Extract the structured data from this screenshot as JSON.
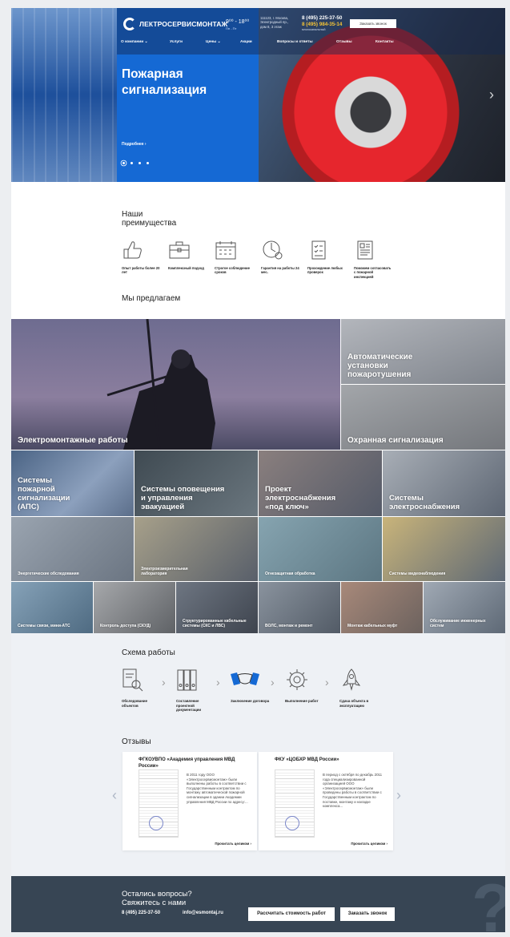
{
  "header": {
    "logo_text": "ЛЕКТРОСЕРВИСМОНТАЖ",
    "hours": "9⁰⁰ - 18⁰⁰",
    "hours_days": "Пн - Пт",
    "address": "111123, г. Москва, Электродный пр., дом 8, 3 этаж",
    "phone1": "8 (495) 225-37-50",
    "phone2": "8 (495) 984-35-14",
    "phone_note": "многоканальный",
    "callback_label": "Заказать звонок",
    "nav": [
      "О компании ⌄",
      "Услуги",
      "Цены ⌄",
      "Акции",
      "Вопросы и ответы",
      "Отзывы",
      "Контакты"
    ]
  },
  "hero": {
    "title": "Пожарная сигнализация",
    "more_label": "Подробнее ›",
    "next_icon": "chevron-right-icon"
  },
  "advantages": {
    "title": "Наши преимущества",
    "items": [
      {
        "icon": "thumbs-up-icon",
        "label": "Опыт работы более 20 лет"
      },
      {
        "icon": "briefcase-icon",
        "label": "Комплексный подход"
      },
      {
        "icon": "calendar-icon",
        "label": "Строгое соблюдение сроков"
      },
      {
        "icon": "warranty-clock-icon",
        "label": "Гарантия на работы 24 мес."
      },
      {
        "icon": "checklist-icon",
        "label": "Прохождение любых проверок"
      },
      {
        "icon": "document-icon",
        "label": "Поможем согласовать с пожарной инспекцией"
      }
    ]
  },
  "offer": {
    "title": "Мы предлагаем",
    "big": [
      {
        "label": "Электромонтажные работы",
        "color": "#6c6b8f"
      },
      {
        "label": "Автоматические установки пожаротушения",
        "color": "#8d9096"
      },
      {
        "label": "Охранная сигнализация",
        "color": "#838588"
      }
    ],
    "row2": [
      {
        "label": "Системы пожарной сигнализации (АПС)",
        "color": "#5b6c84"
      },
      {
        "label": "Системы оповещения и управления эвакуацией",
        "color": "#4d5860"
      },
      {
        "label": "Проект электроснабжения «под ключ»",
        "color": "#6a6e78"
      },
      {
        "label": "Системы электроснабжения",
        "color": "#6f7884"
      }
    ],
    "row3": [
      {
        "label": "Энергетические обследования",
        "color": "#7c8896"
      },
      {
        "label": "Электроизмерительная лаборатория",
        "color": "#6d7580"
      },
      {
        "label": "Огнезащитная обработка",
        "color": "#728c98"
      },
      {
        "label": "Системы видеонаблюдения",
        "color": "#7d8896"
      }
    ],
    "row4": [
      {
        "label": "Системы связи, мини-АТС",
        "color": "#5f7c92"
      },
      {
        "label": "Контроль доступа (СКУД)",
        "color": "#7a7d82"
      },
      {
        "label": "Структурированные кабельные системы (СКС и ЛВС)",
        "color": "#5d6470"
      },
      {
        "label": "ВОЛС, монтаж и ремонт",
        "color": "#6d7682"
      },
      {
        "label": "Монтаж кабельных муфт",
        "color": "#8a7e76"
      },
      {
        "label": "Обслуживание инженерных систем",
        "color": "#707b88"
      }
    ]
  },
  "scheme": {
    "title": "Схема работы",
    "steps": [
      {
        "icon": "inspection-icon",
        "label": "Обследование объектов"
      },
      {
        "icon": "binders-icon",
        "label": "Составление проектной документации"
      },
      {
        "icon": "handshake-icon",
        "label": "Заключение договора"
      },
      {
        "icon": "gear-icon",
        "label": "Выполнение работ"
      },
      {
        "icon": "rocket-icon",
        "label": "Сдача объекта в эксплуатацию"
      }
    ]
  },
  "reviews": {
    "title": "Отзывы",
    "items": [
      {
        "title": "ФГКОУВПО «Академия управления МВД России»",
        "text": "В 2011 году ООО «Электросервисмонтаж» были выполнены работы в соответствии с Государственным контрактом по монтажу автоматической пожарной сигнализации в здании Академии управления МВД России по адресу:...",
        "more": "Прочитать целиком ›"
      },
      {
        "title": "ФКУ «ЦОБХР МВД России»",
        "text": "В период с октября по декабрь 2011 года специализированной организацией ООО «Электросервисмонтаж» были проведены работы в соответствии с Государственным контрактом по поставке, монтажу и наладке комплекса...",
        "more": "Прочитать целиком ›"
      }
    ]
  },
  "footer": {
    "title": "Остались вопросы? Свяжитесь с нами",
    "phone": "8 (495) 225-37-50",
    "email": "info@esmontaj.ru",
    "calc_label": "Рассчитать стоимость работ",
    "callback_label": "Заказать звонок"
  },
  "colors": {
    "accent": "#1569d4",
    "phone_highlight": "#f5c436",
    "footer": "#374554"
  }
}
